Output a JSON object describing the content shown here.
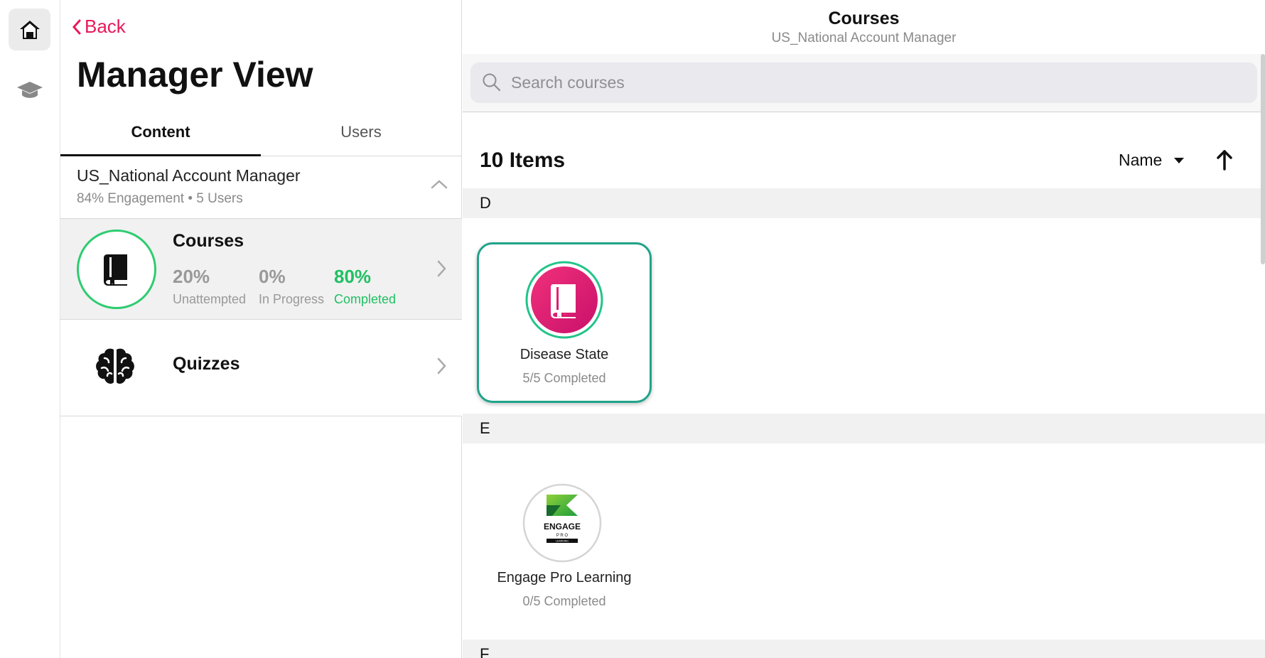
{
  "rail": {
    "items": [
      {
        "icon": "home-icon",
        "active": true
      },
      {
        "icon": "graduation-cap-icon",
        "active": false
      }
    ]
  },
  "left": {
    "back_label": "Back",
    "title": "Manager View",
    "tabs": [
      {
        "label": "Content",
        "active": true
      },
      {
        "label": "Users",
        "active": false
      }
    ],
    "group": {
      "title": "US_National Account Manager",
      "subtitle": "84% Engagement • 5 Users"
    },
    "courses_row": {
      "title": "Courses",
      "stats": [
        {
          "value": "20%",
          "label": "Unattempted"
        },
        {
          "value": "0%",
          "label": "In Progress"
        },
        {
          "value": "80%",
          "label": "Completed"
        }
      ]
    },
    "quizzes_row": {
      "title": "Quizzes"
    }
  },
  "right": {
    "header_title": "Courses",
    "header_subtitle": "US_National Account Manager",
    "search_placeholder": "Search courses",
    "item_count": "10 Items",
    "sort_label": "Name",
    "sections": [
      {
        "letter": "D",
        "items": [
          {
            "name": "Disease State",
            "progress": "5/5 Completed",
            "selected": true,
            "icon": "book-icon"
          }
        ]
      },
      {
        "letter": "E",
        "items": [
          {
            "name": "Engage Pro Learning",
            "progress": "0/5 Completed",
            "selected": false,
            "icon": "engage-pro-logo",
            "logo_text": "ENGAGE",
            "logo_sub": "P R O",
            "logo_band": "LEARNING"
          }
        ]
      },
      {
        "letter": "F",
        "items": []
      }
    ]
  },
  "colors": {
    "accent_pink": "#e8195a",
    "completed_green": "#20c063",
    "selected_border": "#20a38a"
  }
}
